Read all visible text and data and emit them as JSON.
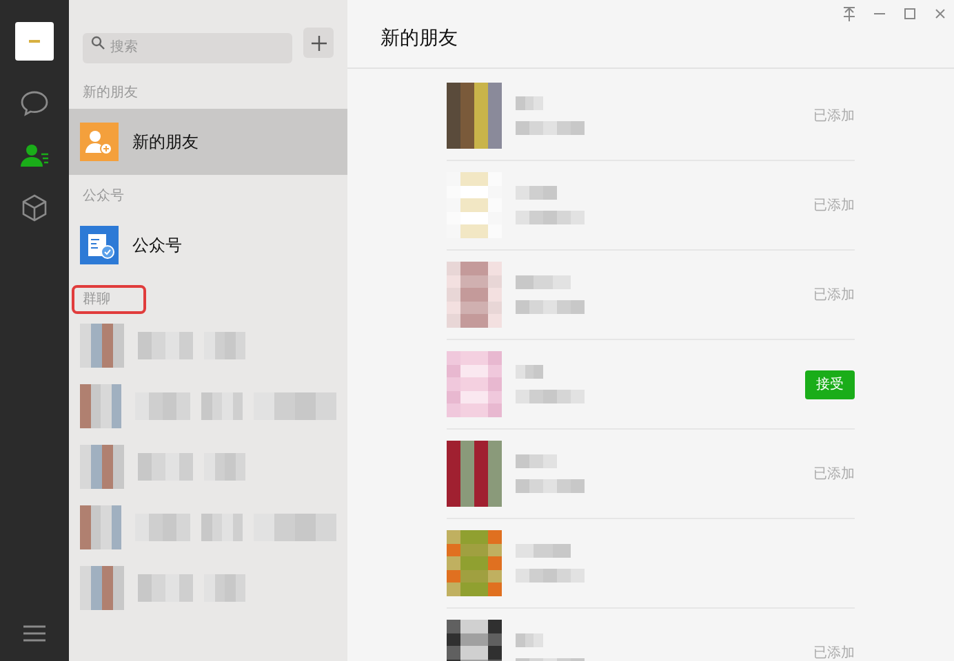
{
  "nav": [
    {
      "kind": "chat",
      "selected": false
    },
    {
      "kind": "contacts",
      "selected": true
    },
    {
      "kind": "box",
      "selected": false
    }
  ],
  "search": {
    "placeholder": "搜索"
  },
  "sections": [
    {
      "label": "新的朋友",
      "highlighted": false,
      "items": [
        {
          "kind": "new-friend",
          "label": "新的朋友",
          "selected": true
        }
      ]
    },
    {
      "label": "公众号",
      "highlighted": false,
      "items": [
        {
          "kind": "official",
          "label": "公众号",
          "selected": false
        }
      ]
    },
    {
      "label": "群聊",
      "highlighted": true,
      "items": [
        {
          "kind": "group",
          "selected": false
        },
        {
          "kind": "group",
          "selected": false
        },
        {
          "kind": "group",
          "selected": false
        },
        {
          "kind": "group",
          "selected": false
        },
        {
          "kind": "group",
          "selected": false
        }
      ]
    }
  ],
  "main": {
    "title": "新的朋友"
  },
  "requests": [
    {
      "kind": "added",
      "status": "已添加"
    },
    {
      "kind": "added",
      "status": "已添加"
    },
    {
      "kind": "added",
      "status": "已添加"
    },
    {
      "kind": "accept",
      "status": "接受"
    },
    {
      "kind": "added",
      "status": "已添加"
    },
    {
      "kind": "hidden"
    },
    {
      "kind": "added",
      "status": "已添加"
    }
  ]
}
